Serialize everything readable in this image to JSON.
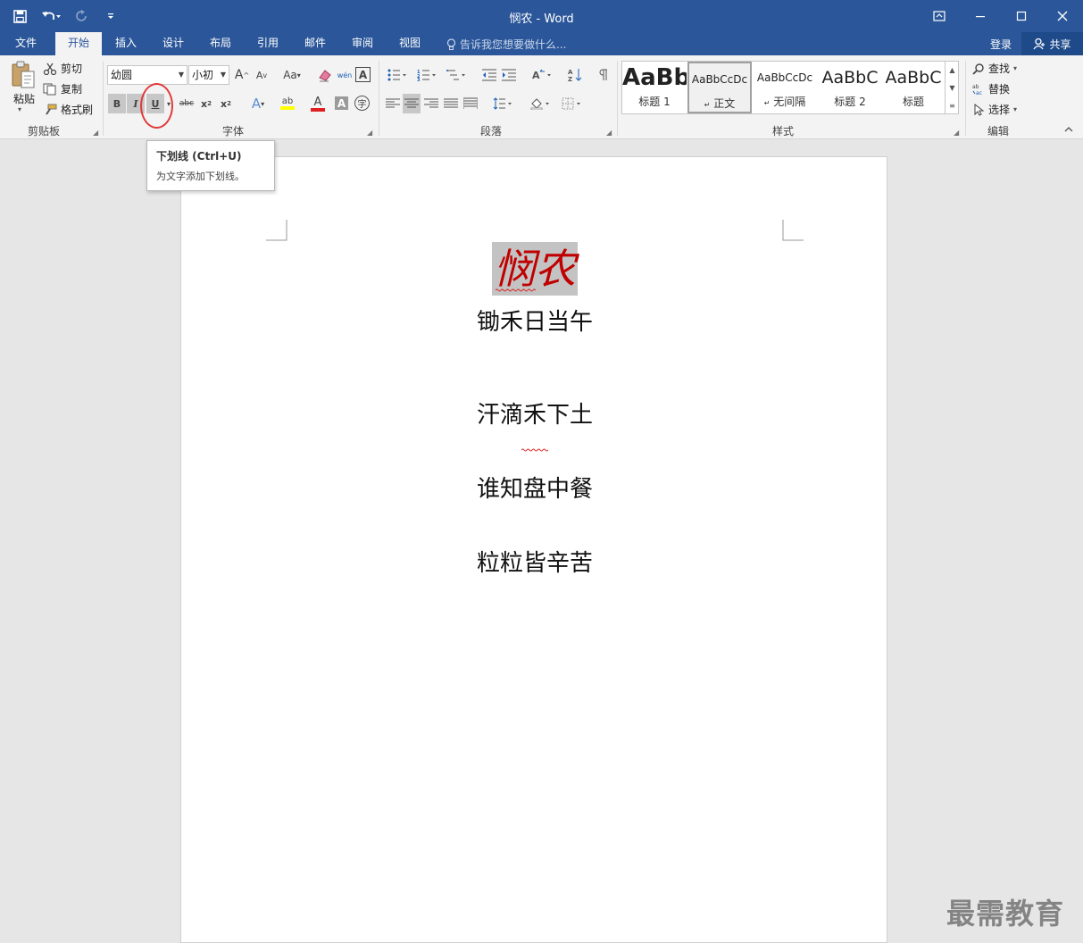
{
  "window": {
    "title": "悯农 - Word",
    "accent": "#2b579a"
  },
  "tabs": [
    {
      "label": "文件"
    },
    {
      "label": "开始"
    },
    {
      "label": "插入"
    },
    {
      "label": "设计"
    },
    {
      "label": "布局"
    },
    {
      "label": "引用"
    },
    {
      "label": "邮件"
    },
    {
      "label": "审阅"
    },
    {
      "label": "视图"
    }
  ],
  "tell_me": "告诉我您想要做什么...",
  "account": {
    "login": "登录",
    "share": "共享"
  },
  "clipboard": {
    "paste": "粘贴",
    "cut": "剪切",
    "copy": "复制",
    "format_painter": "格式刷",
    "label": "剪贴板"
  },
  "font": {
    "name": "幼圆",
    "size": "小初",
    "grow": "A",
    "shrink": "A",
    "case": "Aa",
    "bold": "B",
    "italic": "I",
    "underline": "U",
    "strike": "abc",
    "subscript": "x",
    "superscript": "x",
    "phonetic": "wén",
    "border_char": "A",
    "effects": "A",
    "highlight": "ab",
    "font_color": "A",
    "shading": "A",
    "enclose": "字",
    "label": "字体"
  },
  "paragraph": {
    "label": "段落"
  },
  "styles": {
    "label": "样式",
    "items": [
      {
        "preview": "AaBb",
        "name": "标题 1"
      },
      {
        "preview": "AaBbCcDc",
        "name": "正文"
      },
      {
        "preview": "AaBbCcDc",
        "name": "无间隔"
      },
      {
        "preview": "AaBbC",
        "name": "标题 2"
      },
      {
        "preview": "AaBbC",
        "name": "标题"
      }
    ]
  },
  "editing": {
    "find": "查找",
    "replace": "替换",
    "select": "选择",
    "label": "编辑"
  },
  "tooltip": {
    "title": "下划线 (Ctrl+U)",
    "desc": "为文字添加下划线。"
  },
  "document": {
    "title": "悯农",
    "lines": [
      "锄禾日当午",
      "汗滴禾下土",
      "谁知盘中餐",
      "粒粒皆辛苦"
    ]
  },
  "watermark": "最需教育"
}
